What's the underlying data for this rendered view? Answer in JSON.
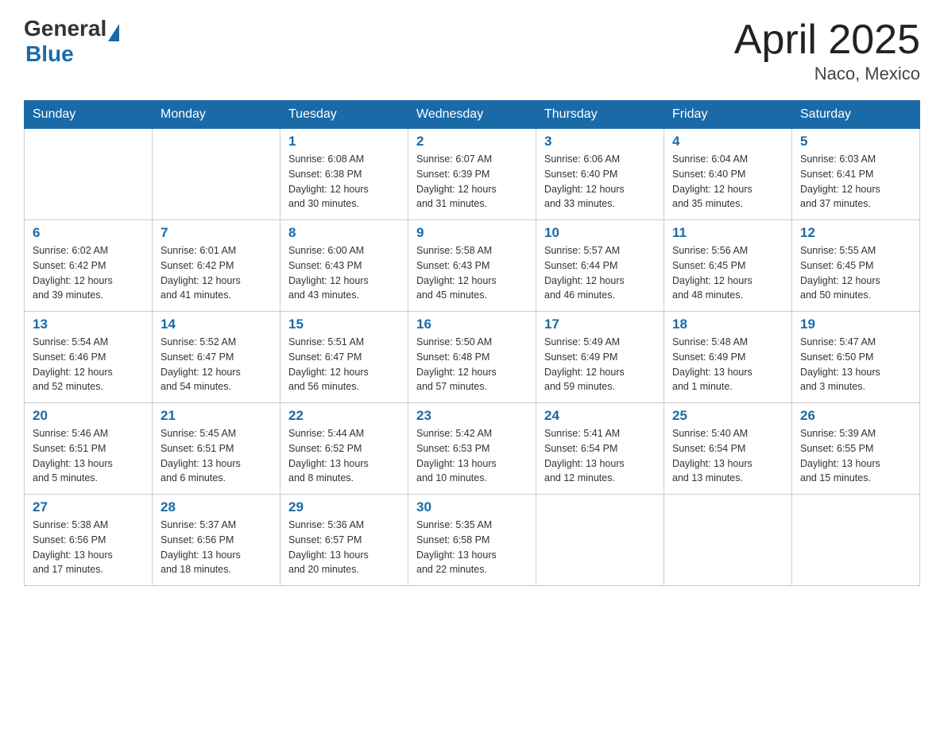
{
  "header": {
    "logo_general": "General",
    "logo_blue": "Blue",
    "title": "April 2025",
    "subtitle": "Naco, Mexico"
  },
  "days_of_week": [
    "Sunday",
    "Monday",
    "Tuesday",
    "Wednesday",
    "Thursday",
    "Friday",
    "Saturday"
  ],
  "weeks": [
    [
      {
        "day": "",
        "info": ""
      },
      {
        "day": "",
        "info": ""
      },
      {
        "day": "1",
        "info": "Sunrise: 6:08 AM\nSunset: 6:38 PM\nDaylight: 12 hours\nand 30 minutes."
      },
      {
        "day": "2",
        "info": "Sunrise: 6:07 AM\nSunset: 6:39 PM\nDaylight: 12 hours\nand 31 minutes."
      },
      {
        "day": "3",
        "info": "Sunrise: 6:06 AM\nSunset: 6:40 PM\nDaylight: 12 hours\nand 33 minutes."
      },
      {
        "day": "4",
        "info": "Sunrise: 6:04 AM\nSunset: 6:40 PM\nDaylight: 12 hours\nand 35 minutes."
      },
      {
        "day": "5",
        "info": "Sunrise: 6:03 AM\nSunset: 6:41 PM\nDaylight: 12 hours\nand 37 minutes."
      }
    ],
    [
      {
        "day": "6",
        "info": "Sunrise: 6:02 AM\nSunset: 6:42 PM\nDaylight: 12 hours\nand 39 minutes."
      },
      {
        "day": "7",
        "info": "Sunrise: 6:01 AM\nSunset: 6:42 PM\nDaylight: 12 hours\nand 41 minutes."
      },
      {
        "day": "8",
        "info": "Sunrise: 6:00 AM\nSunset: 6:43 PM\nDaylight: 12 hours\nand 43 minutes."
      },
      {
        "day": "9",
        "info": "Sunrise: 5:58 AM\nSunset: 6:43 PM\nDaylight: 12 hours\nand 45 minutes."
      },
      {
        "day": "10",
        "info": "Sunrise: 5:57 AM\nSunset: 6:44 PM\nDaylight: 12 hours\nand 46 minutes."
      },
      {
        "day": "11",
        "info": "Sunrise: 5:56 AM\nSunset: 6:45 PM\nDaylight: 12 hours\nand 48 minutes."
      },
      {
        "day": "12",
        "info": "Sunrise: 5:55 AM\nSunset: 6:45 PM\nDaylight: 12 hours\nand 50 minutes."
      }
    ],
    [
      {
        "day": "13",
        "info": "Sunrise: 5:54 AM\nSunset: 6:46 PM\nDaylight: 12 hours\nand 52 minutes."
      },
      {
        "day": "14",
        "info": "Sunrise: 5:52 AM\nSunset: 6:47 PM\nDaylight: 12 hours\nand 54 minutes."
      },
      {
        "day": "15",
        "info": "Sunrise: 5:51 AM\nSunset: 6:47 PM\nDaylight: 12 hours\nand 56 minutes."
      },
      {
        "day": "16",
        "info": "Sunrise: 5:50 AM\nSunset: 6:48 PM\nDaylight: 12 hours\nand 57 minutes."
      },
      {
        "day": "17",
        "info": "Sunrise: 5:49 AM\nSunset: 6:49 PM\nDaylight: 12 hours\nand 59 minutes."
      },
      {
        "day": "18",
        "info": "Sunrise: 5:48 AM\nSunset: 6:49 PM\nDaylight: 13 hours\nand 1 minute."
      },
      {
        "day": "19",
        "info": "Sunrise: 5:47 AM\nSunset: 6:50 PM\nDaylight: 13 hours\nand 3 minutes."
      }
    ],
    [
      {
        "day": "20",
        "info": "Sunrise: 5:46 AM\nSunset: 6:51 PM\nDaylight: 13 hours\nand 5 minutes."
      },
      {
        "day": "21",
        "info": "Sunrise: 5:45 AM\nSunset: 6:51 PM\nDaylight: 13 hours\nand 6 minutes."
      },
      {
        "day": "22",
        "info": "Sunrise: 5:44 AM\nSunset: 6:52 PM\nDaylight: 13 hours\nand 8 minutes."
      },
      {
        "day": "23",
        "info": "Sunrise: 5:42 AM\nSunset: 6:53 PM\nDaylight: 13 hours\nand 10 minutes."
      },
      {
        "day": "24",
        "info": "Sunrise: 5:41 AM\nSunset: 6:54 PM\nDaylight: 13 hours\nand 12 minutes."
      },
      {
        "day": "25",
        "info": "Sunrise: 5:40 AM\nSunset: 6:54 PM\nDaylight: 13 hours\nand 13 minutes."
      },
      {
        "day": "26",
        "info": "Sunrise: 5:39 AM\nSunset: 6:55 PM\nDaylight: 13 hours\nand 15 minutes."
      }
    ],
    [
      {
        "day": "27",
        "info": "Sunrise: 5:38 AM\nSunset: 6:56 PM\nDaylight: 13 hours\nand 17 minutes."
      },
      {
        "day": "28",
        "info": "Sunrise: 5:37 AM\nSunset: 6:56 PM\nDaylight: 13 hours\nand 18 minutes."
      },
      {
        "day": "29",
        "info": "Sunrise: 5:36 AM\nSunset: 6:57 PM\nDaylight: 13 hours\nand 20 minutes."
      },
      {
        "day": "30",
        "info": "Sunrise: 5:35 AM\nSunset: 6:58 PM\nDaylight: 13 hours\nand 22 minutes."
      },
      {
        "day": "",
        "info": ""
      },
      {
        "day": "",
        "info": ""
      },
      {
        "day": "",
        "info": ""
      }
    ]
  ]
}
